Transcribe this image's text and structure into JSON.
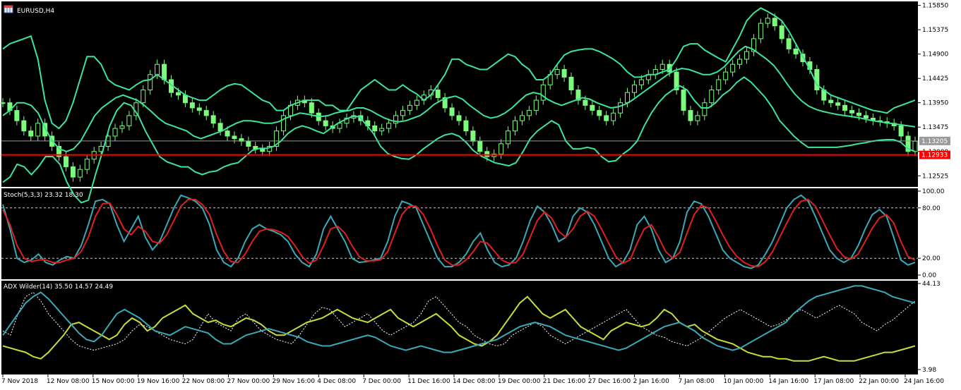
{
  "window": {
    "symbol_title": "EURUSD,H4"
  },
  "colors": {
    "background": "#000000",
    "candles": "#7CFC7C",
    "bollinger": "#3ee39c",
    "horizontal_gray": "#9a9a9a",
    "horizontal_red": "#ff0000",
    "stoch_main": "#3aa9b5",
    "stoch_signal": "#e02020",
    "adx_main": "#3aa9b5",
    "adx_plus_di": "#c8dc3c",
    "adx_minus_di": "#ffffff"
  },
  "chart_data": [
    {
      "type": "line",
      "name": "price",
      "ylim": [
        1.1235,
        1.159
      ],
      "y_ticks": [
        "1.15850",
        "1.15375",
        "1.14900",
        "1.14425",
        "1.13950",
        "1.13475",
        "1.13000",
        "1.12525"
      ],
      "price_labels": {
        "current": "1.13205",
        "red_line": "1.12933"
      },
      "current_price": 1.13205,
      "red_line_price": 1.12933,
      "close": [
        1.1395,
        1.138,
        1.136,
        1.134,
        1.133,
        1.1355,
        1.133,
        1.131,
        1.129,
        1.127,
        1.125,
        1.1265,
        1.1285,
        1.13,
        1.131,
        1.133,
        1.1345,
        1.135,
        1.137,
        1.1395,
        1.142,
        1.145,
        1.147,
        1.144,
        1.1415,
        1.141,
        1.1395,
        1.1385,
        1.138,
        1.137,
        1.1355,
        1.134,
        1.133,
        1.1325,
        1.132,
        1.131,
        1.1305,
        1.13,
        1.131,
        1.134,
        1.137,
        1.139,
        1.14,
        1.1395,
        1.1375,
        1.136,
        1.135,
        1.1345,
        1.1355,
        1.1365,
        1.137,
        1.136,
        1.135,
        1.134,
        1.1345,
        1.1355,
        1.137,
        1.138,
        1.139,
        1.14,
        1.141,
        1.142,
        1.1405,
        1.1385,
        1.137,
        1.136,
        1.134,
        1.132,
        1.13,
        1.129,
        1.1295,
        1.1315,
        1.134,
        1.136,
        1.137,
        1.138,
        1.14,
        1.143,
        1.145,
        1.146,
        1.1445,
        1.142,
        1.14,
        1.139,
        1.138,
        1.137,
        1.136,
        1.1375,
        1.1395,
        1.1415,
        1.143,
        1.144,
        1.145,
        1.146,
        1.147,
        1.1455,
        1.142,
        1.138,
        1.136,
        1.137,
        1.1395,
        1.142,
        1.144,
        1.1455,
        1.147,
        1.148,
        1.1495,
        1.152,
        1.155,
        1.156,
        1.1545,
        1.152,
        1.15,
        1.149,
        1.1475,
        1.146,
        1.142,
        1.14,
        1.1395,
        1.139,
        1.138,
        1.1375,
        1.137,
        1.1365,
        1.136,
        1.1358,
        1.1355,
        1.135,
        1.133,
        1.13,
        1.132
      ],
      "bollinger_upper": [
        1.15,
        1.151,
        1.1515,
        1.152,
        1.1525,
        1.148,
        1.14,
        1.1355,
        1.1345,
        1.136,
        1.1395,
        1.144,
        1.1485,
        1.1485,
        1.147,
        1.144,
        1.143,
        1.1425,
        1.142,
        1.143,
        1.1438,
        1.144,
        1.145,
        1.144,
        1.143,
        1.142,
        1.141,
        1.1405,
        1.14,
        1.14,
        1.141,
        1.142,
        1.1428,
        1.1432,
        1.143,
        1.142,
        1.141,
        1.14,
        1.1395,
        1.138,
        1.138,
        1.139,
        1.1395,
        1.14,
        1.14,
        1.14,
        1.139,
        1.139,
        1.138,
        1.138,
        1.14,
        1.142,
        1.143,
        1.144,
        1.143,
        1.142,
        1.142,
        1.143,
        1.142,
        1.1412,
        1.14,
        1.141,
        1.143,
        1.145,
        1.148,
        1.148,
        1.147,
        1.1465,
        1.146,
        1.146,
        1.147,
        1.148,
        1.149,
        1.1485,
        1.147,
        1.146,
        1.144,
        1.144,
        1.145,
        1.147,
        1.1488,
        1.1495,
        1.1498,
        1.15,
        1.15,
        1.1495,
        1.1488,
        1.148,
        1.147,
        1.1455,
        1.1445,
        1.1445,
        1.145,
        1.145,
        1.1455,
        1.146,
        1.148,
        1.1505,
        1.151,
        1.151,
        1.1498,
        1.149,
        1.1482,
        1.1475,
        1.15,
        1.1525,
        1.1555,
        1.157,
        1.158,
        1.1573,
        1.1565,
        1.1555,
        1.1535,
        1.151,
        1.1485,
        1.146,
        1.143,
        1.142,
        1.141,
        1.1405,
        1.14,
        1.1395,
        1.139,
        1.1385,
        1.138,
        1.1378,
        1.1375,
        1.1385,
        1.139,
        1.1395,
        1.14
      ],
      "bollinger_middle": [
        1.137,
        1.138,
        1.1395,
        1.1395,
        1.139,
        1.1375,
        1.1345,
        1.132,
        1.1305,
        1.13,
        1.1305,
        1.132,
        1.1345,
        1.137,
        1.1385,
        1.1395,
        1.1405,
        1.141,
        1.1405,
        1.14,
        1.139,
        1.1378,
        1.1365,
        1.1355,
        1.135,
        1.1345,
        1.134,
        1.133,
        1.1325,
        1.133,
        1.1335,
        1.134,
        1.1348,
        1.1355,
        1.136,
        1.136,
        1.1358,
        1.1355,
        1.1355,
        1.1358,
        1.1365,
        1.137,
        1.1375,
        1.1373,
        1.137,
        1.1368,
        1.137,
        1.1375,
        1.1378,
        1.138,
        1.1385,
        1.1385,
        1.138,
        1.1372,
        1.1365,
        1.136,
        1.1358,
        1.136,
        1.1365,
        1.137,
        1.138,
        1.1392,
        1.14,
        1.1405,
        1.1408,
        1.1402,
        1.139,
        1.138,
        1.137,
        1.1365,
        1.1368,
        1.1375,
        1.1385,
        1.1398,
        1.141,
        1.1415,
        1.1412,
        1.1402,
        1.1395,
        1.139,
        1.1395,
        1.14,
        1.1405,
        1.1402,
        1.1395,
        1.139,
        1.1385,
        1.1387,
        1.1392,
        1.14,
        1.141,
        1.142,
        1.143,
        1.144,
        1.145,
        1.1458,
        1.1462,
        1.146,
        1.1455,
        1.145,
        1.145,
        1.1455,
        1.1465,
        1.148,
        1.1495,
        1.1505,
        1.15,
        1.149,
        1.148,
        1.1468,
        1.145,
        1.143,
        1.1412,
        1.1398,
        1.1388,
        1.1382,
        1.1378,
        1.1375,
        1.1372,
        1.137,
        1.1368,
        1.1366,
        1.1363,
        1.136,
        1.1358,
        1.1356,
        1.1354,
        1.1352,
        1.135,
        1.1348
      ],
      "bollinger_lower": [
        1.124,
        1.125,
        1.1275,
        1.127,
        1.1255,
        1.127,
        1.129,
        1.129,
        1.1275,
        1.124,
        1.1215,
        1.12,
        1.1205,
        1.1255,
        1.13,
        1.135,
        1.138,
        1.1395,
        1.139,
        1.137,
        1.134,
        1.1315,
        1.129,
        1.128,
        1.1275,
        1.127,
        1.127,
        1.126,
        1.1255,
        1.126,
        1.1262,
        1.127,
        1.1275,
        1.1278,
        1.129,
        1.1302,
        1.1306,
        1.1306,
        1.131,
        1.132,
        1.1335,
        1.1345,
        1.135,
        1.1346,
        1.134,
        1.1335,
        1.1345,
        1.1355,
        1.1362,
        1.1368,
        1.1368,
        1.1352,
        1.1335,
        1.131,
        1.1296,
        1.129,
        1.1286,
        1.1285,
        1.1293,
        1.1305,
        1.1315,
        1.1325,
        1.1332,
        1.1335,
        1.133,
        1.1318,
        1.1302,
        1.1292,
        1.1285,
        1.1278,
        1.1275,
        1.1272,
        1.1278,
        1.13,
        1.1325,
        1.134,
        1.135,
        1.136,
        1.1352,
        1.132,
        1.1305,
        1.1305,
        1.1308,
        1.1305,
        1.129,
        1.128,
        1.1282,
        1.1295,
        1.1305,
        1.132,
        1.135,
        1.1375,
        1.1395,
        1.141,
        1.142,
        1.1428,
        1.142,
        1.14,
        1.1385,
        1.1385,
        1.1395,
        1.141,
        1.142,
        1.1435,
        1.1445,
        1.1435,
        1.142,
        1.1405,
        1.1385,
        1.136,
        1.1345,
        1.133,
        1.1318,
        1.1308,
        1.1308,
        1.1308,
        1.1308,
        1.1308,
        1.131,
        1.1312,
        1.1315,
        1.1317,
        1.132,
        1.1322,
        1.1323,
        1.1323,
        1.1318,
        1.1305,
        1.13
      ]
    },
    {
      "type": "line",
      "name": "stochastic",
      "title": "Stoch(5,3,3) 23.32 18.30",
      "ylim": [
        0,
        100
      ],
      "y_ticks": [
        "100.00",
        "80.00",
        "20.00",
        "0.00"
      ],
      "levels": [
        80,
        20
      ],
      "main": [
        84,
        55,
        20,
        15,
        18,
        25,
        15,
        12,
        18,
        22,
        20,
        35,
        60,
        88,
        90,
        85,
        60,
        40,
        55,
        70,
        45,
        30,
        40,
        60,
        80,
        95,
        92,
        88,
        80,
        60,
        30,
        15,
        10,
        20,
        40,
        55,
        60,
        55,
        52,
        48,
        40,
        25,
        15,
        10,
        25,
        55,
        70,
        55,
        40,
        20,
        15,
        16,
        18,
        20,
        40,
        70,
        88,
        85,
        80,
        60,
        40,
        20,
        10,
        10,
        15,
        25,
        40,
        50,
        30,
        15,
        10,
        12,
        20,
        40,
        65,
        82,
        75,
        60,
        40,
        45,
        70,
        80,
        75,
        60,
        40,
        20,
        10,
        15,
        30,
        60,
        70,
        55,
        30,
        15,
        20,
        40,
        75,
        88,
        85,
        70,
        50,
        30,
        20,
        15,
        10,
        8,
        12,
        25,
        40,
        60,
        80,
        90,
        95,
        88,
        70,
        50,
        30,
        20,
        15,
        20,
        35,
        55,
        72,
        78,
        70,
        45,
        18,
        12,
        15
      ],
      "signal": [
        78,
        60,
        35,
        20,
        16,
        18,
        18,
        15,
        15,
        18,
        20,
        28,
        45,
        70,
        85,
        86,
        72,
        55,
        48,
        58,
        52,
        40,
        38,
        48,
        65,
        82,
        90,
        90,
        84,
        72,
        48,
        28,
        16,
        15,
        25,
        40,
        52,
        55,
        54,
        51,
        46,
        35,
        22,
        14,
        18,
        35,
        55,
        58,
        50,
        35,
        22,
        17,
        17,
        18,
        28,
        50,
        72,
        82,
        82,
        72,
        55,
        35,
        18,
        12,
        12,
        18,
        28,
        40,
        38,
        28,
        18,
        14,
        15,
        25,
        45,
        65,
        75,
        68,
        52,
        45,
        55,
        70,
        76,
        70,
        55,
        38,
        22,
        14,
        18,
        38,
        55,
        60,
        45,
        28,
        20,
        27,
        50,
        72,
        83,
        80,
        65,
        48,
        33,
        22,
        15,
        11,
        10,
        16,
        28,
        45,
        62,
        78,
        88,
        90,
        82,
        65,
        48,
        32,
        22,
        19,
        25,
        40,
        56,
        68,
        72,
        62,
        40,
        22,
        18
      ]
    },
    {
      "type": "line",
      "name": "adx",
      "title": "ADX Wilder(14) 35.50 14.57 24.49",
      "ylim": [
        3.98,
        44.13
      ],
      "y_ticks": [
        "44.13",
        "3.98"
      ],
      "adx": [
        20,
        25,
        30,
        35,
        38,
        40,
        37,
        33,
        29,
        25,
        21,
        18,
        17,
        20,
        25,
        30,
        32,
        30,
        28,
        25,
        22,
        21,
        20,
        22,
        24,
        23,
        22,
        21,
        18,
        16,
        16,
        18,
        20,
        21,
        22,
        23,
        22,
        21,
        20,
        19,
        17,
        16,
        15,
        15,
        16,
        17,
        18,
        19,
        20,
        19,
        17,
        15,
        14,
        13,
        14,
        15,
        14,
        13,
        12,
        12,
        13,
        14,
        15,
        16,
        17,
        18,
        20,
        22,
        24,
        25,
        26,
        25,
        24,
        22,
        20,
        19,
        18,
        17,
        16,
        15,
        14,
        13,
        14,
        16,
        18,
        20,
        22,
        24,
        25,
        26,
        24,
        22,
        19,
        17,
        15,
        14,
        13,
        14,
        16,
        18,
        20,
        22,
        24,
        26,
        30,
        33,
        36,
        38,
        39,
        40,
        41,
        42,
        43,
        43,
        42,
        41,
        40,
        38,
        37,
        36,
        35
      ],
      "plus_di": [
        15,
        14,
        13,
        12,
        10,
        9,
        12,
        16,
        20,
        25,
        26,
        24,
        22,
        20,
        18,
        20,
        25,
        28,
        26,
        22,
        24,
        28,
        30,
        32,
        34,
        30,
        28,
        26,
        27,
        25,
        24,
        26,
        28,
        27,
        25,
        22,
        20,
        20,
        22,
        24,
        26,
        27,
        28,
        30,
        32,
        30,
        28,
        27,
        26,
        28,
        30,
        32,
        28,
        26,
        24,
        26,
        28,
        30,
        27,
        24,
        20,
        18,
        16,
        15,
        17,
        20,
        25,
        30,
        35,
        38,
        34,
        30,
        28,
        30,
        32,
        28,
        24,
        22,
        20,
        18,
        22,
        24,
        26,
        25,
        24,
        25,
        28,
        32,
        30,
        26,
        24,
        25,
        22,
        20,
        18,
        17,
        16,
        14,
        12,
        11,
        10,
        10,
        9,
        9,
        8,
        8,
        8,
        9,
        10,
        9,
        8,
        8,
        8,
        9,
        10,
        11,
        12,
        12,
        13,
        14,
        15
      ],
      "minus_di": [
        22,
        20,
        30,
        38,
        40,
        36,
        30,
        26,
        22,
        18,
        15,
        14,
        13,
        14,
        15,
        16,
        18,
        22,
        25,
        24,
        22,
        20,
        18,
        17,
        16,
        18,
        24,
        30,
        26,
        24,
        22,
        28,
        30,
        26,
        22,
        20,
        18,
        17,
        16,
        20,
        25,
        30,
        33,
        32,
        28,
        24,
        26,
        28,
        30,
        26,
        22,
        20,
        22,
        24,
        26,
        30,
        36,
        38,
        34,
        30,
        26,
        24,
        20,
        18,
        16,
        15,
        16,
        20,
        22,
        24,
        26,
        24,
        20,
        18,
        16,
        18,
        20,
        22,
        24,
        26,
        28,
        30,
        32,
        28,
        24,
        22,
        20,
        19,
        17,
        16,
        15,
        17,
        19,
        22,
        25,
        28,
        30,
        32,
        30,
        28,
        26,
        24,
        25,
        27,
        30,
        32,
        30,
        28,
        30,
        32,
        34,
        32,
        30,
        26,
        24,
        22,
        25,
        27,
        30,
        33,
        36
      ]
    },
    {
      "type": "line",
      "name": "time-axis",
      "x_ticks": [
        "7 Nov 2018",
        "12 Nov 08:00",
        "15 Nov 00:00",
        "19 Nov 16:00",
        "22 Nov 08:00",
        "27 Nov 00:00",
        "29 Nov 16:00",
        "4 Dec 08:00",
        "7 Dec 00:00",
        "11 Dec 16:00",
        "14 Dec 08:00",
        "19 Dec 00:00",
        "21 Dec 16:00",
        "27 Dec 16:00",
        "2 Jan 16:00",
        "7 Jan 08:00",
        "10 Jan 00:00",
        "14 Jan 16:00",
        "17 Jan 08:00",
        "22 Jan 00:00",
        "24 Jan 16:00"
      ]
    }
  ]
}
